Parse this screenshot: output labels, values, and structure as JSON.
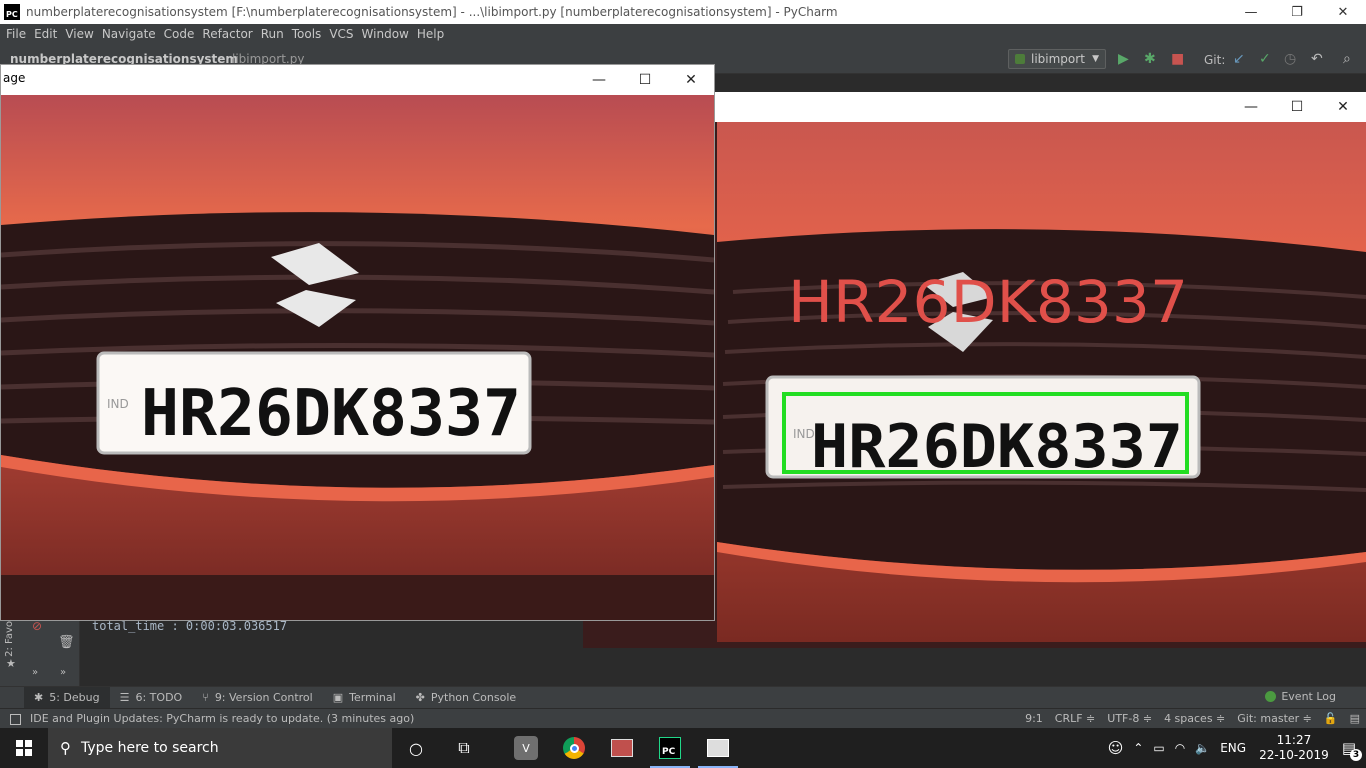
{
  "titlebar": {
    "app_icon": "PC",
    "title": "numberplaterecognisationsystem [F:\\numberplaterecognisationsystem] - ...\\libimport.py [numberplaterecognisationsystem] - PyCharm",
    "minimize": "—",
    "maximize": "❐",
    "close": "✕"
  },
  "menu": [
    "File",
    "Edit",
    "View",
    "Navigate",
    "Code",
    "Refactor",
    "Run",
    "Tools",
    "VCS",
    "Window",
    "Help"
  ],
  "toolbar": {
    "project": "numberplaterecognisationsystem",
    "file": "libimport.py",
    "run_config": "libimport",
    "git_label": "Git:"
  },
  "image_window_left": {
    "title": "age",
    "minimize": "—",
    "maximize": "☐",
    "close": "✕",
    "plate_text": "HR26DK8337",
    "plate_prefix": "IND"
  },
  "image_window_right": {
    "minimize": "—",
    "maximize": "☐",
    "close": "✕",
    "recognized_text": "HR26DK8337",
    "plate_text": "HR26DK8337",
    "plate_prefix": "IND",
    "recognized_color": "#e0504a",
    "box_color": "#22dd22"
  },
  "debug_console": {
    "output_line": "total_time : 0:00:03.036517",
    "favorites": "2: Favo"
  },
  "tool_tabs": [
    {
      "label": "5: Debug",
      "icon": "bug-icon"
    },
    {
      "label": "6: TODO",
      "icon": "list-icon"
    },
    {
      "label": "9: Version Control",
      "icon": "branch-icon"
    },
    {
      "label": "Terminal",
      "icon": "terminal-icon"
    },
    {
      "label": "Python Console",
      "icon": "python-icon"
    }
  ],
  "event_log": "Event Log",
  "statusbar": {
    "message": "IDE and Plugin Updates: PyCharm is ready to update. (3 minutes ago)",
    "position": "9:1",
    "line_sep": "CRLF ≑",
    "encoding": "UTF-8 ≑",
    "indent": "4 spaces ≑",
    "git": "Git: master ≑"
  },
  "taskbar": {
    "search_placeholder": "Type here to search",
    "language": "ENG",
    "time": "11:27",
    "date": "22-10-2019",
    "notifications": "3"
  }
}
